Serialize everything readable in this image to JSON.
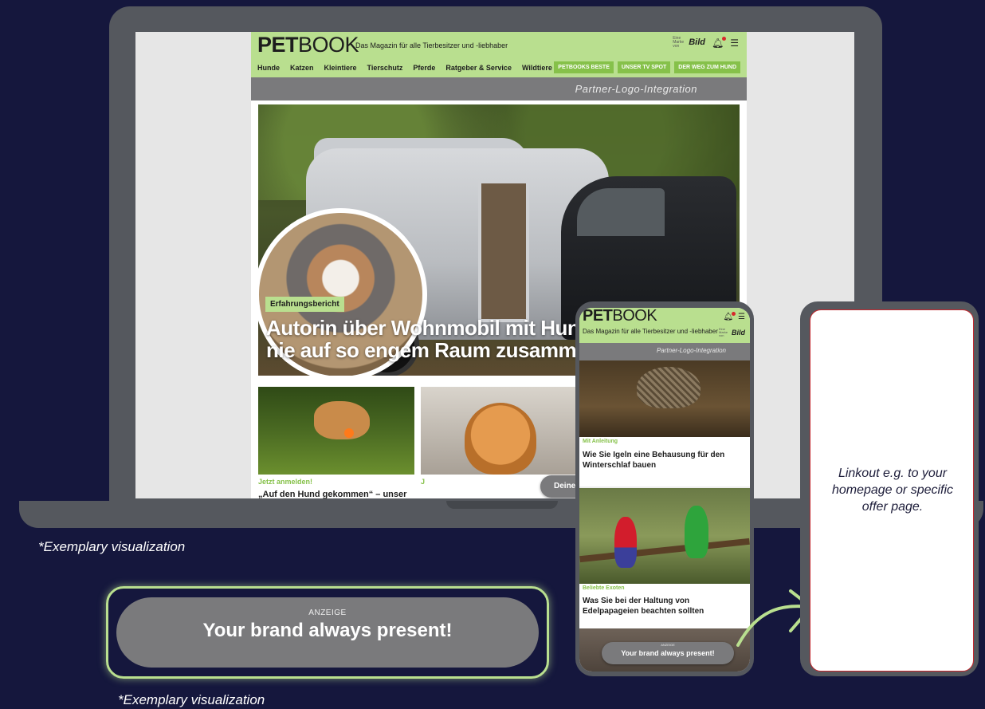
{
  "desktop": {
    "site": {
      "logo_bold": "PET",
      "logo_thin": "BOOK",
      "tagline": "Das Magazin für alle Tierbesitzer und -liebhaber",
      "brandmark_small": "Eine Marke von",
      "brandmark_bild": "Bild",
      "nav": [
        "Hunde",
        "Katzen",
        "Kleintiere",
        "Tierschutz",
        "Pferde",
        "Ratgeber & Service",
        "Wildtiere"
      ],
      "nav_buttons": [
        "PETBOOKS BESTE",
        "UNSER TV SPOT",
        "DER WEG ZUM HUND"
      ],
      "partner_label": "Partner-Logo-Integration",
      "hero": {
        "badge": "Erfahrungsbericht",
        "title_line1": "Autorin über Wohnmobil mit Hund:",
        "title_line2": "nie auf so engem Raum zusammen"
      },
      "cards": [
        {
          "kicker": "Jetzt anmelden!",
          "title": "„Auf den Hund gekommen“ – unser"
        },
        {
          "kicker": "J",
          "title": ""
        }
      ],
      "ad_pill": {
        "ad_label": "ANZEIGE",
        "text": "Deine Marke immer präsent!"
      }
    },
    "caption": "*Exemplary visualization"
  },
  "big_pill": {
    "ad_label": "ANZEIGE",
    "text": "Your brand always present!"
  },
  "caption_bottom": "*Exemplary visualization",
  "mobile": {
    "logo_bold": "PET",
    "logo_thin": "BOOK",
    "tagline": "Das Magazin für alle Tierbesitzer und -liebhaber",
    "brandmark_small": "Eine Marke von",
    "brandmark_bild": "Bild",
    "partner_label": "Partner-Logo-Integration",
    "articles": [
      {
        "kicker": "Mit Anleitung",
        "title": "Wie Sie Igeln eine Behausung für den Winterschlaf bauen"
      },
      {
        "kicker": "Beliebte Exoten",
        "title": "Was Sie bei der Haltung von Edelpapageien beachten sollten"
      }
    ],
    "ad_pill": {
      "ad_label": "ANZEIGE",
      "text": "Your brand always present!"
    }
  },
  "linkout": {
    "text": "Linkout e.g. to your homepage or specific offer page."
  },
  "colors": {
    "background": "#15173d",
    "device_frame": "#55585e",
    "brand_green": "#b9df8f",
    "accent_green": "#86c14a",
    "pill_gray": "#7a7a7c",
    "linkout_border": "#c4272d"
  }
}
